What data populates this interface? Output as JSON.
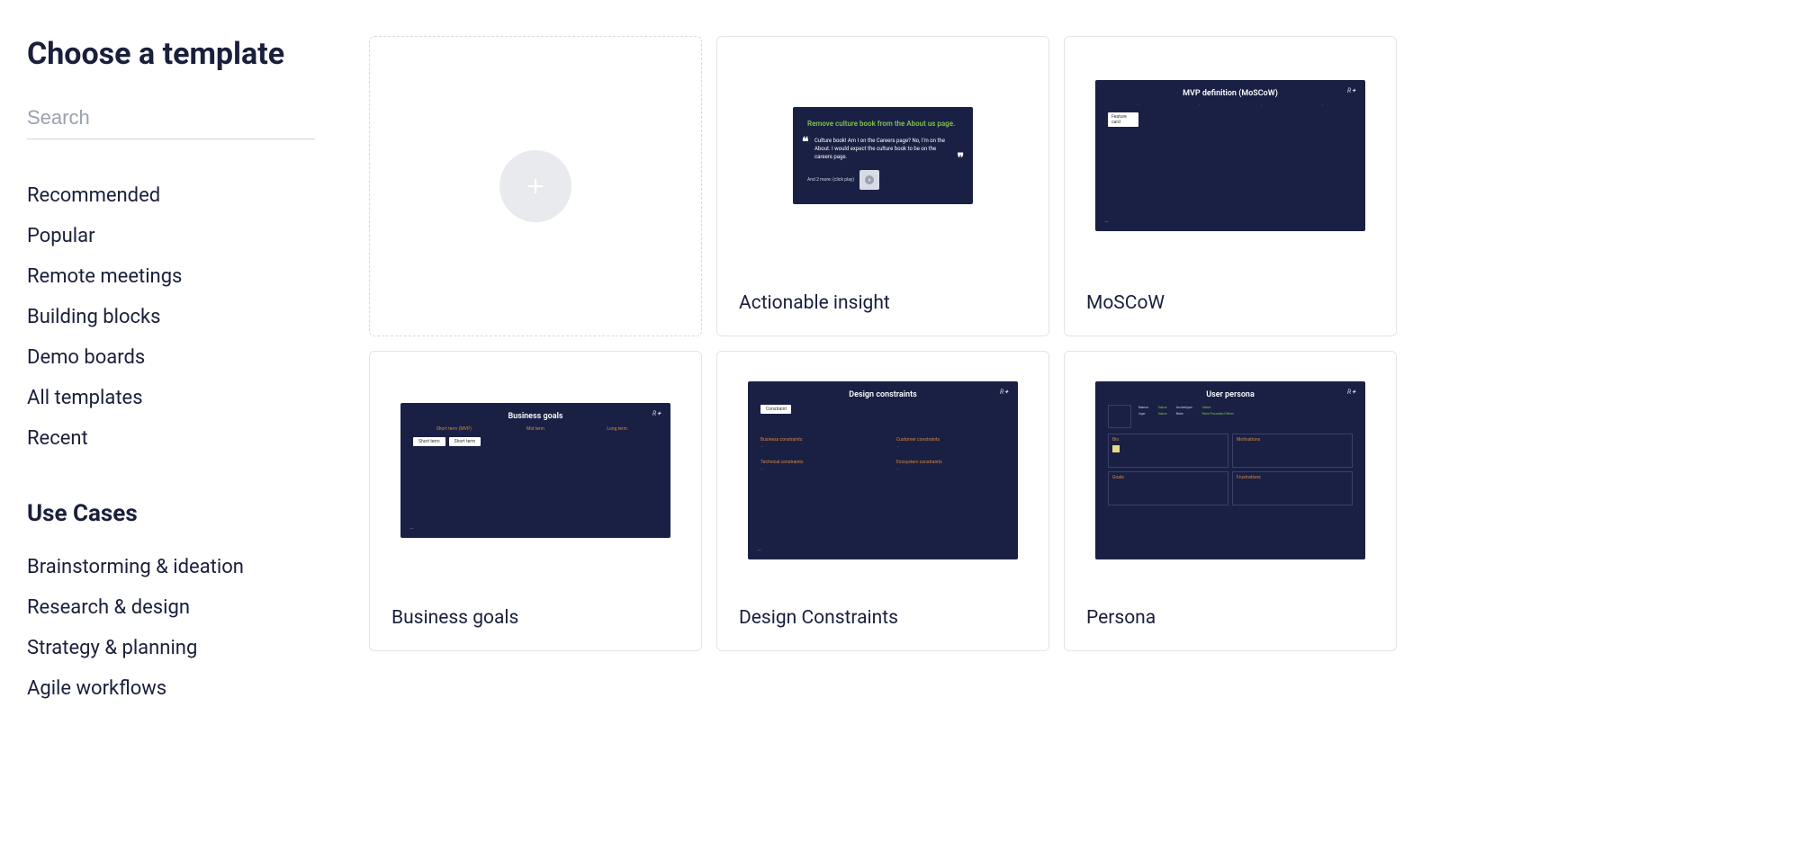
{
  "page_title": "Choose a template",
  "search": {
    "placeholder": "Search",
    "value": ""
  },
  "nav_primary": [
    "Recommended",
    "Popular",
    "Remote meetings",
    "Building blocks",
    "Demo boards",
    "All templates",
    "Recent"
  ],
  "use_cases_heading": "Use Cases",
  "nav_usecases": [
    "Brainstorming & ideation",
    "Research & design",
    "Strategy & planning",
    "Agile workflows"
  ],
  "templates": [
    {
      "title": "Actionable insight"
    },
    {
      "title": "MoSCoW"
    },
    {
      "title": "Business goals"
    },
    {
      "title": "Design Constraints"
    },
    {
      "title": "Persona"
    }
  ],
  "previews": {
    "actionable": {
      "headline": "Remove culture book from the About us page.",
      "quote": "Culture book! Am I on the Careers page? No, I'm on the About. I would expect the culture book to be on the careers page.",
      "more": "And 2 more: (click play)"
    },
    "moscow": {
      "title": "MVP definition (MoSCoW)",
      "card": "Feature card"
    },
    "business": {
      "title": "Business goals",
      "cols": [
        "Short term (MVP)",
        "Mid term",
        "Long term"
      ],
      "chip": "Short term"
    },
    "constraints": {
      "title": "Design constraints",
      "chip": "Constraint",
      "items": [
        "Business constraints",
        "Customer constraints",
        "Technical constraints",
        "Ecosystem constraints"
      ]
    },
    "persona": {
      "title": "User persona",
      "fields": {
        "name": "Name:",
        "arch": "Archetype:",
        "age": "Age:",
        "role": "Role:",
        "val": "Value",
        "rf": "Role/Founder/Other"
      },
      "boxes": [
        "Bio",
        "Motivations",
        "Goals",
        "Frustrations"
      ]
    }
  }
}
